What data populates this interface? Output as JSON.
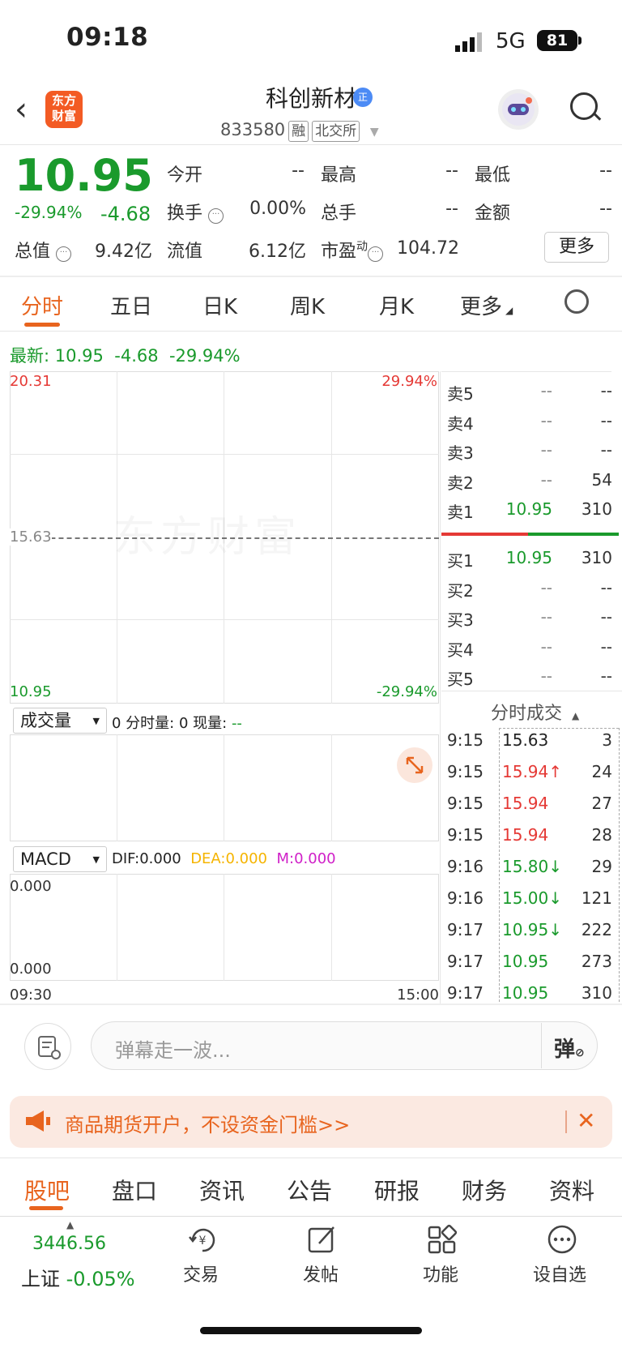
{
  "status_bar": {
    "time": "09:18",
    "network": "5G",
    "battery": "81"
  },
  "header": {
    "logo_text": "东方财富",
    "stock_name": "科创新材",
    "verify_badge": "正",
    "stock_code": "833580",
    "tags": [
      "融",
      "北交所"
    ]
  },
  "quote": {
    "price": "10.95",
    "change_pct": "-29.94%",
    "change": "-4.68",
    "fields": [
      {
        "label": "今开",
        "value": "--"
      },
      {
        "label": "最高",
        "value": "--"
      },
      {
        "label": "最低",
        "value": "--"
      },
      {
        "label": "换手",
        "value": "0.00%"
      },
      {
        "label": "总手",
        "value": "--"
      },
      {
        "label": "金额",
        "value": "--"
      },
      {
        "label": "总值",
        "value": "9.42亿"
      },
      {
        "label": "流值",
        "value": "6.12亿"
      },
      {
        "label": "市盈",
        "sup": "动",
        "value": "104.72"
      }
    ],
    "more_label": "更多"
  },
  "chart_tabs": [
    "分时",
    "五日",
    "日K",
    "周K",
    "月K",
    "更多"
  ],
  "latest": {
    "label": "最新:",
    "price": "10.95",
    "change": "-4.68",
    "pct": "-29.94%"
  },
  "chart_data": {
    "type": "line",
    "y_top_price": "20.31",
    "y_mid_price": "15.63",
    "y_bottom_price": "10.95",
    "y_top_pct": "29.94%",
    "y_bottom_pct": "-29.94%",
    "x_start": "09:30",
    "x_end": "15:00",
    "watermark": "东方财富"
  },
  "volume_panel": {
    "selector": "成交量",
    "readout_a": "0 分时量: 0 现量:",
    "readout_b": "--"
  },
  "macd_panel": {
    "selector": "MACD",
    "dif": "DIF:0.000",
    "dea": "DEA:0.000",
    "m": "M:0.000",
    "top_val": "0.000",
    "bottom_val": "0.000"
  },
  "order_book": {
    "asks": [
      {
        "label": "卖5",
        "price": "--",
        "vol": "--"
      },
      {
        "label": "卖4",
        "price": "--",
        "vol": "--"
      },
      {
        "label": "卖3",
        "price": "--",
        "vol": "--"
      },
      {
        "label": "卖2",
        "price": "--",
        "vol": "54"
      },
      {
        "label": "卖1",
        "price": "10.95",
        "vol": "310"
      }
    ],
    "bids": [
      {
        "label": "买1",
        "price": "10.95",
        "vol": "310"
      },
      {
        "label": "买2",
        "price": "--",
        "vol": "--"
      },
      {
        "label": "买3",
        "price": "--",
        "vol": "--"
      },
      {
        "label": "买4",
        "price": "--",
        "vol": "--"
      },
      {
        "label": "买5",
        "price": "--",
        "vol": "--"
      }
    ],
    "ticks_title": "分时成交",
    "ticks": [
      {
        "time": "9:15",
        "price": "15.63",
        "vol": "3"
      },
      {
        "time": "9:15",
        "price": "15.94↑",
        "vol": "24"
      },
      {
        "time": "9:15",
        "price": "15.94",
        "vol": "27"
      },
      {
        "time": "9:15",
        "price": "15.94",
        "vol": "28"
      },
      {
        "time": "9:16",
        "price": "15.80↓",
        "vol": "29"
      },
      {
        "time": "9:16",
        "price": "15.00↓",
        "vol": "121"
      },
      {
        "time": "9:17",
        "price": "10.95↓",
        "vol": "222"
      },
      {
        "time": "9:17",
        "price": "10.95",
        "vol": "273"
      },
      {
        "time": "9:17",
        "price": "10.95",
        "vol": "310"
      }
    ]
  },
  "comment": {
    "placeholder": "弹幕走一波...",
    "dan_label": "弹"
  },
  "ad": {
    "text": "商品期货开户，不设资金门槛>>"
  },
  "bottom_tabs": [
    "股吧",
    "盘口",
    "资讯",
    "公告",
    "研报",
    "财务",
    "资料"
  ],
  "bottom_nav": {
    "index_value": "3446.56",
    "index_name": "上证",
    "index_change": "-0.05%",
    "items": [
      "交易",
      "发帖",
      "功能",
      "设自选"
    ]
  },
  "colors": {
    "up": "#e53935",
    "down": "#1a9a2c",
    "accent": "#e8641e"
  }
}
